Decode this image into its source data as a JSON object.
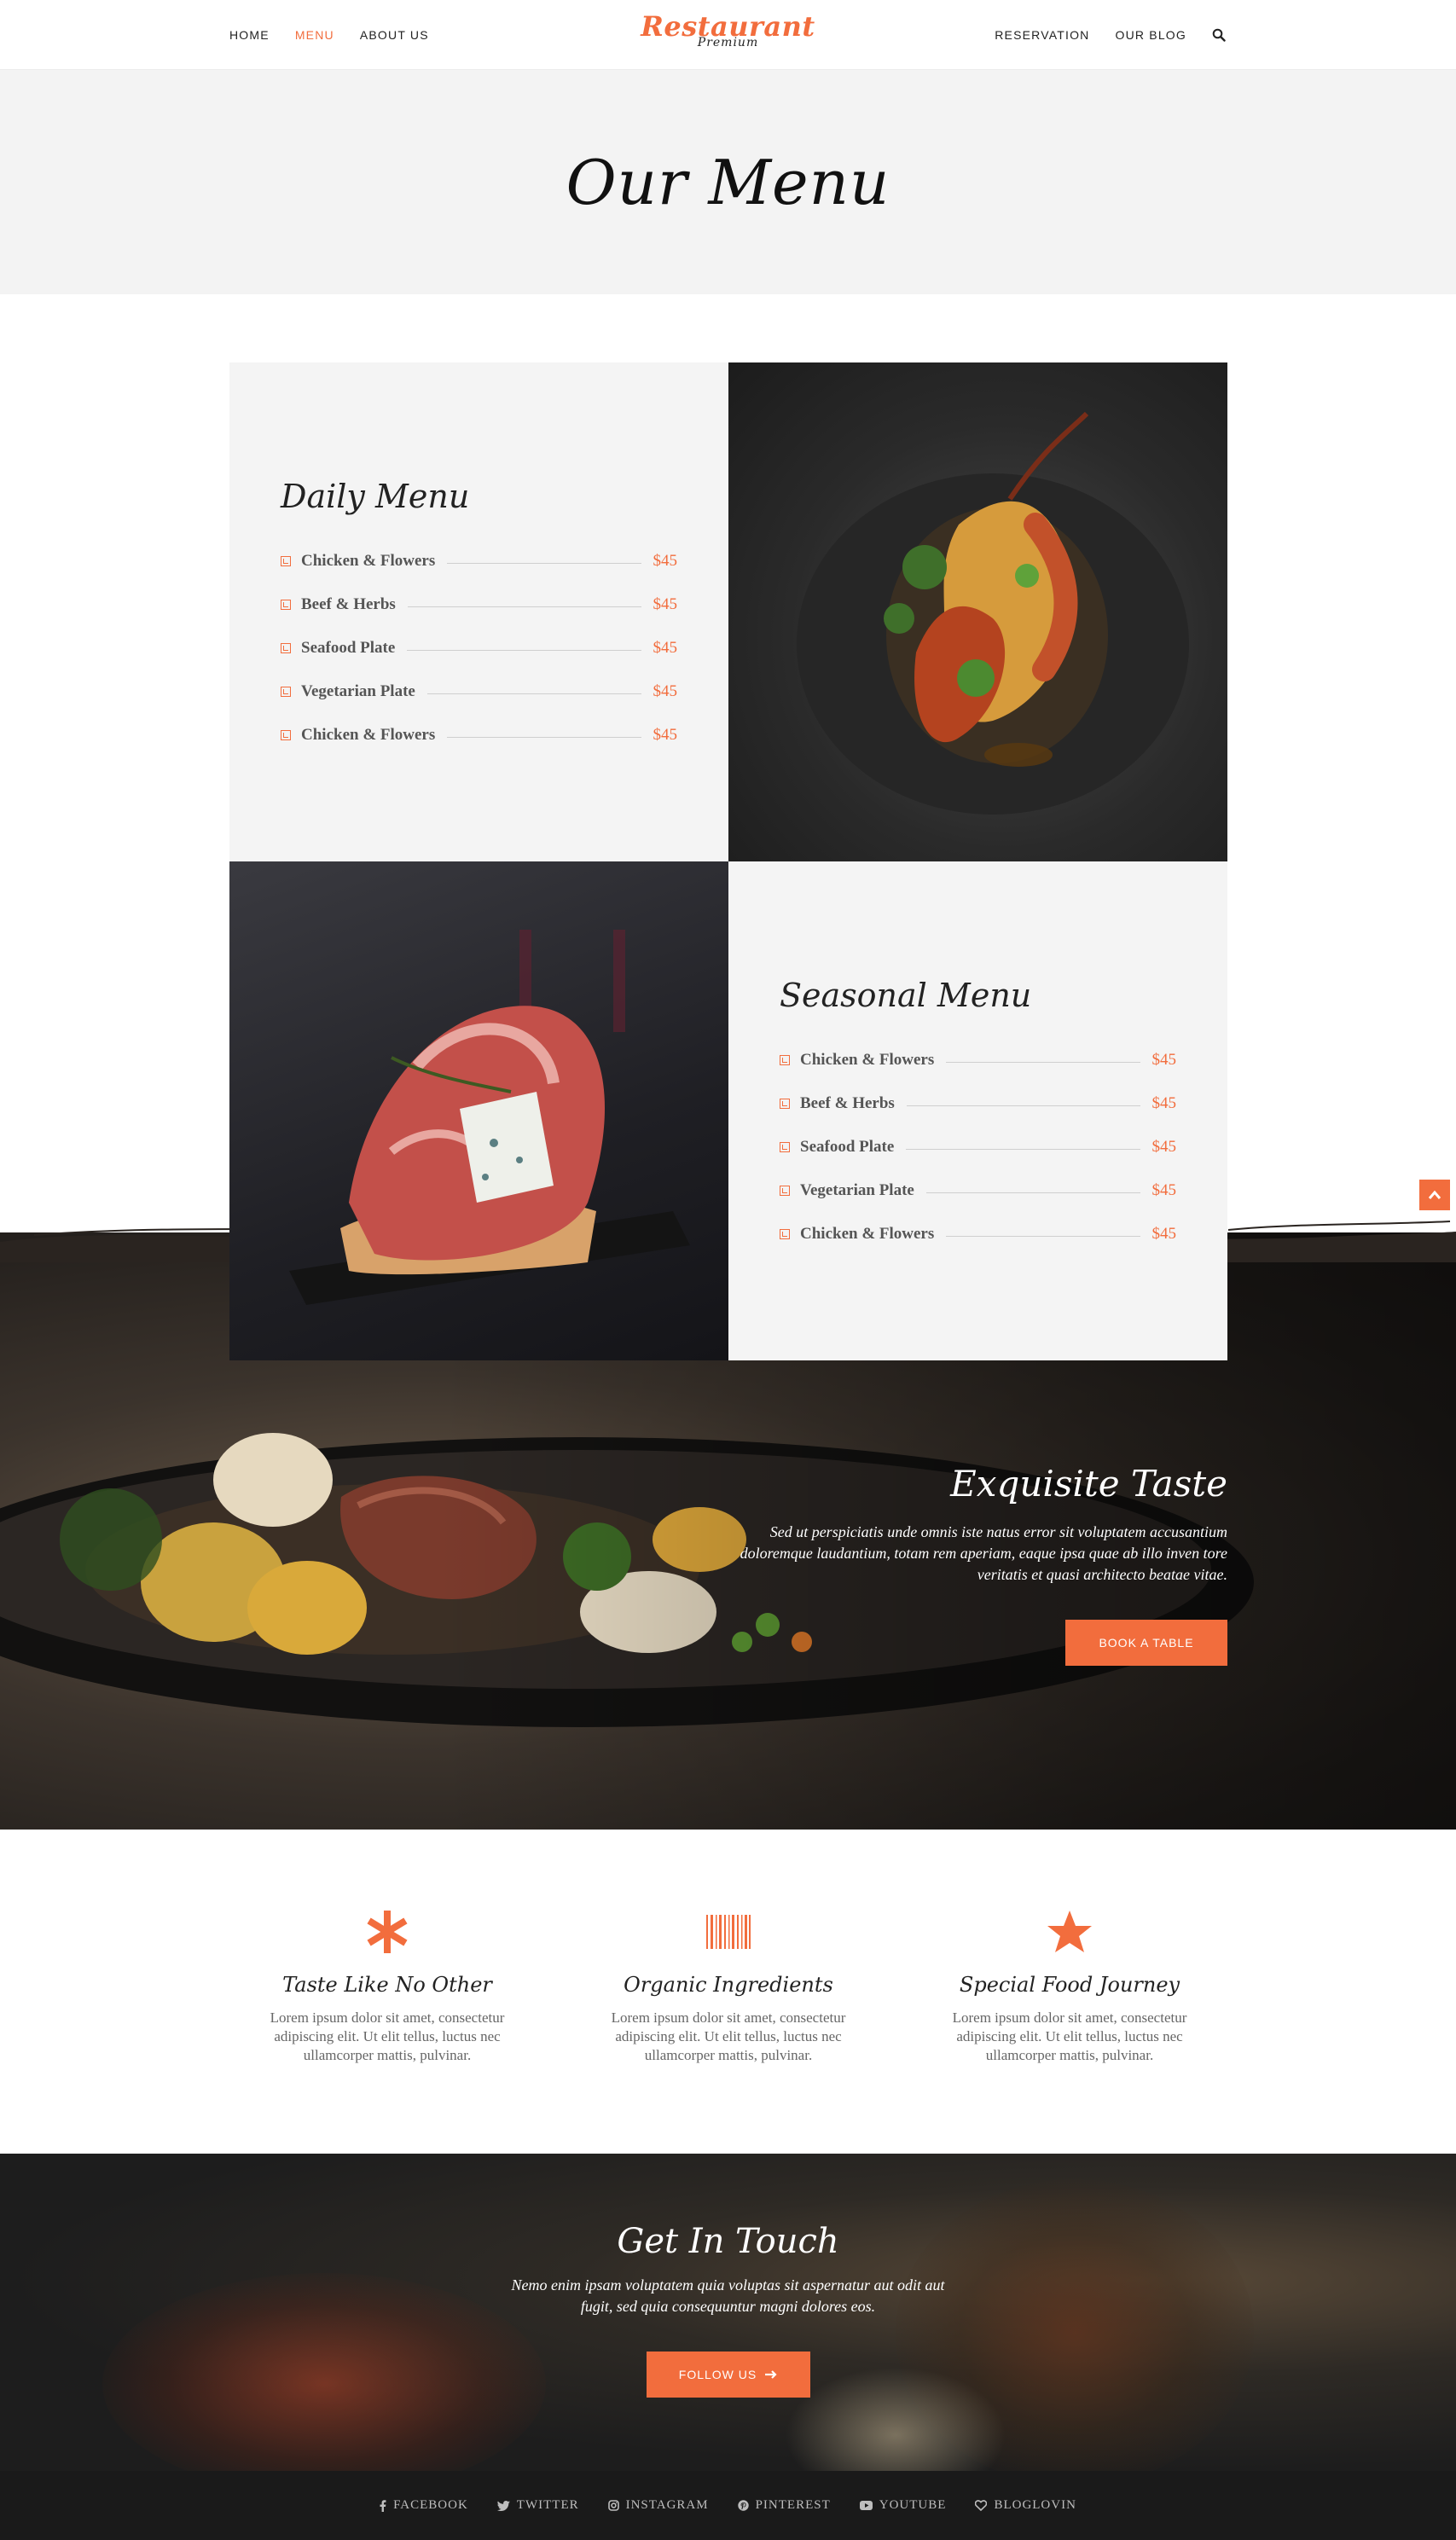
{
  "nav": {
    "left": [
      "HOME",
      "MENU",
      "ABOUT US"
    ],
    "right": [
      "RESERVATION",
      "OUR BLOG"
    ],
    "logo_main": "Restaurant",
    "logo_sub": "Premium"
  },
  "hero": {
    "title": "Our Menu"
  },
  "daily": {
    "heading": "Daily Menu",
    "items": [
      {
        "name": "Chicken & Flowers",
        "price": "$45"
      },
      {
        "name": "Beef & Herbs",
        "price": "$45"
      },
      {
        "name": "Seafood Plate",
        "price": "$45"
      },
      {
        "name": "Vegetarian Plate",
        "price": "$45"
      },
      {
        "name": "Chicken & Flowers",
        "price": "$45"
      }
    ]
  },
  "seasonal": {
    "heading": "Seasonal Menu",
    "items": [
      {
        "name": "Chicken & Flowers",
        "price": "$45"
      },
      {
        "name": "Beef & Herbs",
        "price": "$45"
      },
      {
        "name": "Seafood Plate",
        "price": "$45"
      },
      {
        "name": "Vegetarian Plate",
        "price": "$45"
      },
      {
        "name": "Chicken & Flowers",
        "price": "$45"
      }
    ]
  },
  "taste": {
    "title": "Exquisite Taste",
    "desc": "Sed ut perspiciatis unde omnis iste natus error sit voluptatem accusantium doloremque laudantium, totam rem aperiam, eaque ipsa quae ab illo inven tore veritatis et quasi architecto beatae vitae.",
    "button": "BOOK A TABLE"
  },
  "features": [
    {
      "title": "Taste Like No Other",
      "desc": "Lorem ipsum dolor sit amet, consectetur adipiscing elit. Ut elit tellus, luctus nec ullamcorper mattis, pulvinar.",
      "icon": "asterisk-icon"
    },
    {
      "title": "Organic Ingredients",
      "desc": "Lorem ipsum dolor sit amet, consectetur adipiscing elit. Ut elit tellus, luctus nec ullamcorper mattis, pulvinar.",
      "icon": "barcode-icon"
    },
    {
      "title": "Special Food Journey",
      "desc": "Lorem ipsum dolor sit amet, consectetur adipiscing elit. Ut elit tellus, luctus nec ullamcorper mattis, pulvinar.",
      "icon": "star-icon"
    }
  ],
  "touch": {
    "title": "Get In Touch",
    "desc": "Nemo enim ipsam voluptatem quia voluptas sit aspernatur aut odit aut fugit, sed quia consequuntur magni dolores eos.",
    "button": "FOLLOW US"
  },
  "footer": {
    "links": [
      "FACEBOOK",
      "TWITTER",
      "INSTAGRAM",
      "PINTEREST",
      "YOUTUBE",
      "BLOGLOVIN"
    ]
  },
  "colors": {
    "accent": "#f26d3d",
    "light_bg": "#f4f4f4",
    "dark_footer": "#1a1a1a"
  }
}
